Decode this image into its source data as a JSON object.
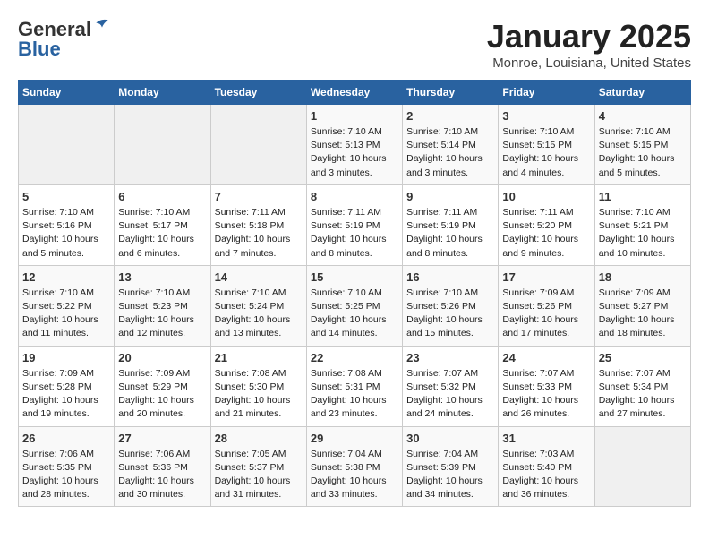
{
  "logo": {
    "general": "General",
    "blue": "Blue"
  },
  "title": "January 2025",
  "subtitle": "Monroe, Louisiana, United States",
  "days_of_week": [
    "Sunday",
    "Monday",
    "Tuesday",
    "Wednesday",
    "Thursday",
    "Friday",
    "Saturday"
  ],
  "weeks": [
    [
      {
        "day": "",
        "sunrise": "",
        "sunset": "",
        "daylight": "",
        "empty": true
      },
      {
        "day": "",
        "sunrise": "",
        "sunset": "",
        "daylight": "",
        "empty": true
      },
      {
        "day": "",
        "sunrise": "",
        "sunset": "",
        "daylight": "",
        "empty": true
      },
      {
        "day": "1",
        "sunrise": "Sunrise: 7:10 AM",
        "sunset": "Sunset: 5:13 PM",
        "daylight": "Daylight: 10 hours and 3 minutes.",
        "empty": false
      },
      {
        "day": "2",
        "sunrise": "Sunrise: 7:10 AM",
        "sunset": "Sunset: 5:14 PM",
        "daylight": "Daylight: 10 hours and 3 minutes.",
        "empty": false
      },
      {
        "day": "3",
        "sunrise": "Sunrise: 7:10 AM",
        "sunset": "Sunset: 5:15 PM",
        "daylight": "Daylight: 10 hours and 4 minutes.",
        "empty": false
      },
      {
        "day": "4",
        "sunrise": "Sunrise: 7:10 AM",
        "sunset": "Sunset: 5:15 PM",
        "daylight": "Daylight: 10 hours and 5 minutes.",
        "empty": false
      }
    ],
    [
      {
        "day": "5",
        "sunrise": "Sunrise: 7:10 AM",
        "sunset": "Sunset: 5:16 PM",
        "daylight": "Daylight: 10 hours and 5 minutes.",
        "empty": false
      },
      {
        "day": "6",
        "sunrise": "Sunrise: 7:10 AM",
        "sunset": "Sunset: 5:17 PM",
        "daylight": "Daylight: 10 hours and 6 minutes.",
        "empty": false
      },
      {
        "day": "7",
        "sunrise": "Sunrise: 7:11 AM",
        "sunset": "Sunset: 5:18 PM",
        "daylight": "Daylight: 10 hours and 7 minutes.",
        "empty": false
      },
      {
        "day": "8",
        "sunrise": "Sunrise: 7:11 AM",
        "sunset": "Sunset: 5:19 PM",
        "daylight": "Daylight: 10 hours and 8 minutes.",
        "empty": false
      },
      {
        "day": "9",
        "sunrise": "Sunrise: 7:11 AM",
        "sunset": "Sunset: 5:19 PM",
        "daylight": "Daylight: 10 hours and 8 minutes.",
        "empty": false
      },
      {
        "day": "10",
        "sunrise": "Sunrise: 7:11 AM",
        "sunset": "Sunset: 5:20 PM",
        "daylight": "Daylight: 10 hours and 9 minutes.",
        "empty": false
      },
      {
        "day": "11",
        "sunrise": "Sunrise: 7:10 AM",
        "sunset": "Sunset: 5:21 PM",
        "daylight": "Daylight: 10 hours and 10 minutes.",
        "empty": false
      }
    ],
    [
      {
        "day": "12",
        "sunrise": "Sunrise: 7:10 AM",
        "sunset": "Sunset: 5:22 PM",
        "daylight": "Daylight: 10 hours and 11 minutes.",
        "empty": false
      },
      {
        "day": "13",
        "sunrise": "Sunrise: 7:10 AM",
        "sunset": "Sunset: 5:23 PM",
        "daylight": "Daylight: 10 hours and 12 minutes.",
        "empty": false
      },
      {
        "day": "14",
        "sunrise": "Sunrise: 7:10 AM",
        "sunset": "Sunset: 5:24 PM",
        "daylight": "Daylight: 10 hours and 13 minutes.",
        "empty": false
      },
      {
        "day": "15",
        "sunrise": "Sunrise: 7:10 AM",
        "sunset": "Sunset: 5:25 PM",
        "daylight": "Daylight: 10 hours and 14 minutes.",
        "empty": false
      },
      {
        "day": "16",
        "sunrise": "Sunrise: 7:10 AM",
        "sunset": "Sunset: 5:26 PM",
        "daylight": "Daylight: 10 hours and 15 minutes.",
        "empty": false
      },
      {
        "day": "17",
        "sunrise": "Sunrise: 7:09 AM",
        "sunset": "Sunset: 5:26 PM",
        "daylight": "Daylight: 10 hours and 17 minutes.",
        "empty": false
      },
      {
        "day": "18",
        "sunrise": "Sunrise: 7:09 AM",
        "sunset": "Sunset: 5:27 PM",
        "daylight": "Daylight: 10 hours and 18 minutes.",
        "empty": false
      }
    ],
    [
      {
        "day": "19",
        "sunrise": "Sunrise: 7:09 AM",
        "sunset": "Sunset: 5:28 PM",
        "daylight": "Daylight: 10 hours and 19 minutes.",
        "empty": false
      },
      {
        "day": "20",
        "sunrise": "Sunrise: 7:09 AM",
        "sunset": "Sunset: 5:29 PM",
        "daylight": "Daylight: 10 hours and 20 minutes.",
        "empty": false
      },
      {
        "day": "21",
        "sunrise": "Sunrise: 7:08 AM",
        "sunset": "Sunset: 5:30 PM",
        "daylight": "Daylight: 10 hours and 21 minutes.",
        "empty": false
      },
      {
        "day": "22",
        "sunrise": "Sunrise: 7:08 AM",
        "sunset": "Sunset: 5:31 PM",
        "daylight": "Daylight: 10 hours and 23 minutes.",
        "empty": false
      },
      {
        "day": "23",
        "sunrise": "Sunrise: 7:07 AM",
        "sunset": "Sunset: 5:32 PM",
        "daylight": "Daylight: 10 hours and 24 minutes.",
        "empty": false
      },
      {
        "day": "24",
        "sunrise": "Sunrise: 7:07 AM",
        "sunset": "Sunset: 5:33 PM",
        "daylight": "Daylight: 10 hours and 26 minutes.",
        "empty": false
      },
      {
        "day": "25",
        "sunrise": "Sunrise: 7:07 AM",
        "sunset": "Sunset: 5:34 PM",
        "daylight": "Daylight: 10 hours and 27 minutes.",
        "empty": false
      }
    ],
    [
      {
        "day": "26",
        "sunrise": "Sunrise: 7:06 AM",
        "sunset": "Sunset: 5:35 PM",
        "daylight": "Daylight: 10 hours and 28 minutes.",
        "empty": false
      },
      {
        "day": "27",
        "sunrise": "Sunrise: 7:06 AM",
        "sunset": "Sunset: 5:36 PM",
        "daylight": "Daylight: 10 hours and 30 minutes.",
        "empty": false
      },
      {
        "day": "28",
        "sunrise": "Sunrise: 7:05 AM",
        "sunset": "Sunset: 5:37 PM",
        "daylight": "Daylight: 10 hours and 31 minutes.",
        "empty": false
      },
      {
        "day": "29",
        "sunrise": "Sunrise: 7:04 AM",
        "sunset": "Sunset: 5:38 PM",
        "daylight": "Daylight: 10 hours and 33 minutes.",
        "empty": false
      },
      {
        "day": "30",
        "sunrise": "Sunrise: 7:04 AM",
        "sunset": "Sunset: 5:39 PM",
        "daylight": "Daylight: 10 hours and 34 minutes.",
        "empty": false
      },
      {
        "day": "31",
        "sunrise": "Sunrise: 7:03 AM",
        "sunset": "Sunset: 5:40 PM",
        "daylight": "Daylight: 10 hours and 36 minutes.",
        "empty": false
      },
      {
        "day": "",
        "sunrise": "",
        "sunset": "",
        "daylight": "",
        "empty": true
      }
    ]
  ]
}
